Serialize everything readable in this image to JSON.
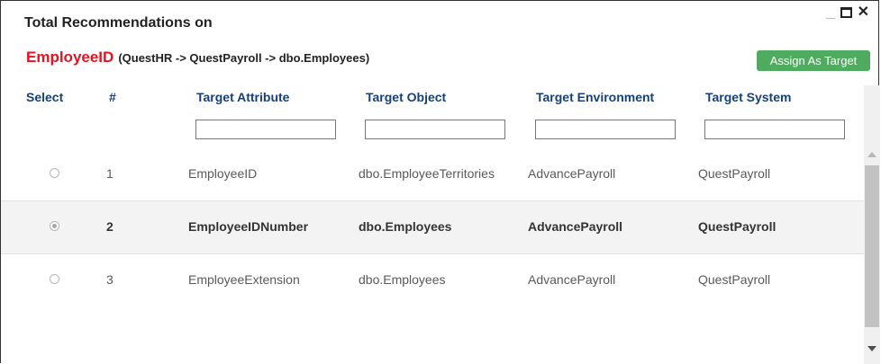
{
  "dialog": {
    "title": "Total Recommendations on",
    "entity": "EmployeeID",
    "path": "(QuestHR -> QuestPayroll -> dbo.Employees)",
    "assign_button": "Assign As Target",
    "window_controls": [
      "minimize-icon",
      "maximize-icon",
      "close-icon"
    ]
  },
  "table": {
    "headers": {
      "select": "Select",
      "num": "#",
      "attr": "Target Attribute",
      "obj": "Target Object",
      "env": "Target Environment",
      "sys": "Target System"
    },
    "filters": {
      "attr": "",
      "obj": "",
      "env": "",
      "sys": ""
    },
    "rows": [
      {
        "num": "1",
        "attr": "EmployeeID",
        "obj": "dbo.EmployeeTerritories",
        "env": "AdvancePayroll",
        "sys": "QuestPayroll",
        "selected": false
      },
      {
        "num": "2",
        "attr": "EmployeeIDNumber",
        "obj": "dbo.Employees",
        "env": "AdvancePayroll",
        "sys": "QuestPayroll",
        "selected": true
      },
      {
        "num": "3",
        "attr": "EmployeeExtension",
        "obj": "dbo.Employees",
        "env": "AdvancePayroll",
        "sys": "QuestPayroll",
        "selected": false
      }
    ]
  },
  "colors": {
    "entity": "#e8121e",
    "header": "#16407a",
    "button": "#4eab5f",
    "selected_row": "#f3f3f3"
  }
}
